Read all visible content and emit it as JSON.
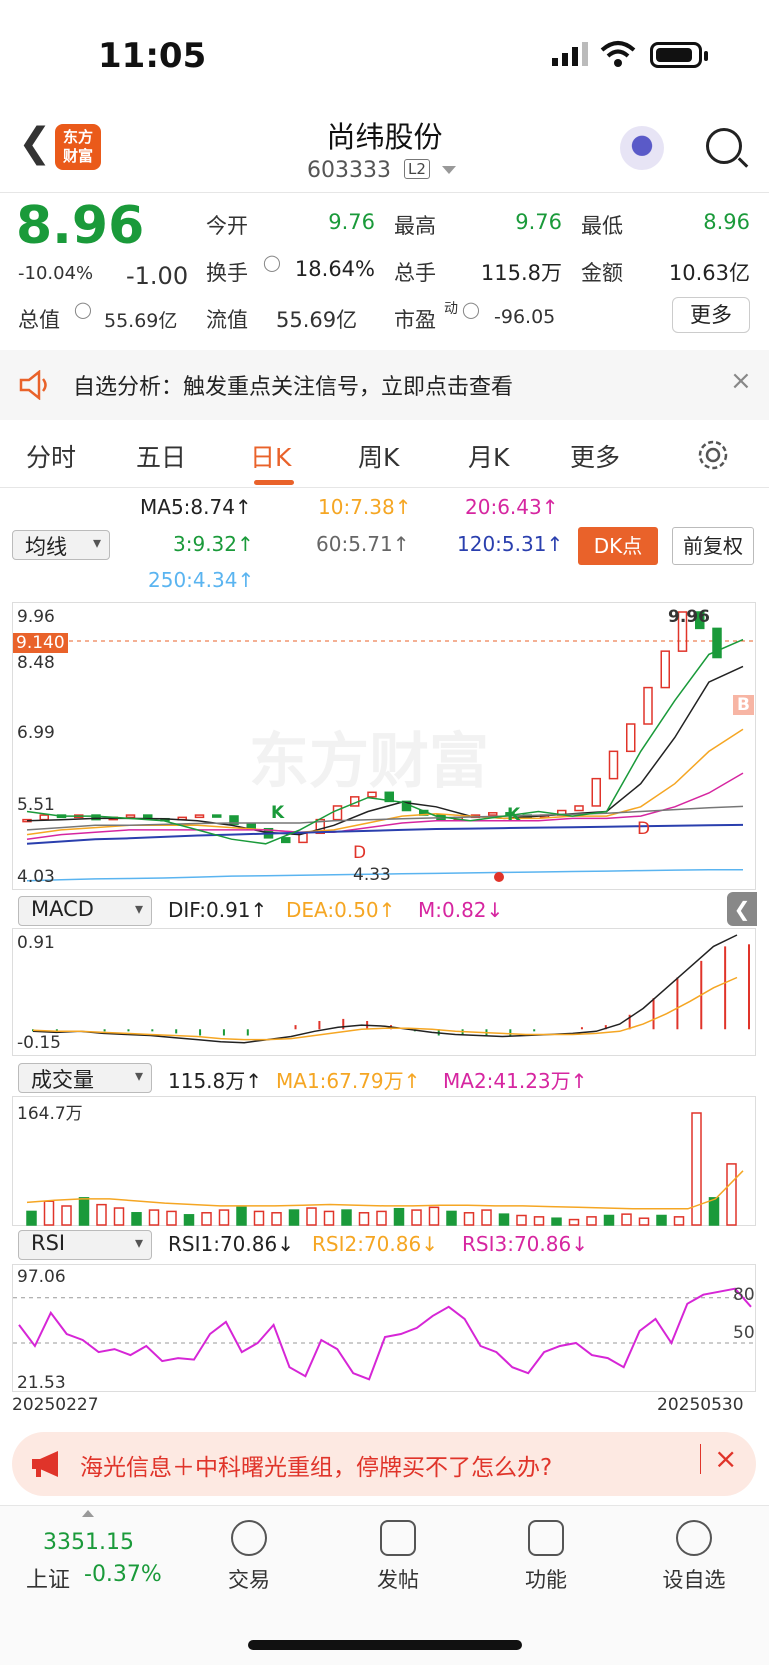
{
  "status": {
    "time": "11:05"
  },
  "header": {
    "logo_l1": "东方",
    "logo_l2": "财富",
    "title": "尚纬股份",
    "code": "603333",
    "level": "L2"
  },
  "quote": {
    "price": "8.96",
    "pct": "-10.04%",
    "chg": "-1.00",
    "r1": [
      {
        "k": "今开",
        "v": "9.76"
      },
      {
        "k": "最高",
        "v": "9.76"
      },
      {
        "k": "最低",
        "v": "8.96"
      }
    ],
    "r2": [
      {
        "k": "换手",
        "v": "18.64%"
      },
      {
        "k": "总手",
        "v": "115.8万"
      },
      {
        "k": "金额",
        "v": "10.63亿"
      }
    ],
    "r3": [
      {
        "k": "总值",
        "v": "55.69亿"
      },
      {
        "k": "流值",
        "v": "55.69亿"
      },
      {
        "k": "市盈",
        "sup": "动",
        "v": "-96.05"
      }
    ],
    "more": "更多"
  },
  "alert": {
    "text": "自选分析：触发重点关注信号，立即点击查看"
  },
  "tabs": [
    "分时",
    "五日",
    "日K",
    "周K",
    "月K",
    "更多"
  ],
  "ma": {
    "selector": "均线",
    "ma5": "MA5:8.74↑",
    "ma10": "10:7.38↑",
    "ma20": "20:6.43↑",
    "ma3": "3:9.32↑",
    "ma60": "60:5.71↑",
    "ma120": "120:5.31↑",
    "ma250": "250:4.34↑",
    "dk": "DK点",
    "fq": "前复权"
  },
  "kline": {
    "y_top": "9.96",
    "cur": "9.140",
    "y2": "8.48",
    "y3": "6.99",
    "y4": "5.51",
    "y_bot": "4.03",
    "hi": "9.96",
    "lo": "4.33",
    "watermark": "东方财富",
    "d1": "D",
    "d2": "D",
    "k1": "K",
    "k2": "K",
    "b": "B"
  },
  "macd": {
    "selector": "MACD",
    "dif": "DIF:0.91↑",
    "dea": "DEA:0.50↑",
    "m": "M:0.82↓",
    "top": "0.91",
    "bot": "-0.15"
  },
  "vol": {
    "selector": "成交量",
    "v": "115.8万↑",
    "ma1": "MA1:67.79万↑",
    "ma2": "MA2:41.23万↑",
    "top": "164.7万"
  },
  "rsi": {
    "selector": "RSI",
    "r1": "RSI1:70.86↓",
    "r2": "RSI2:70.86↓",
    "r3": "RSI3:70.86↓",
    "top": "97.06",
    "bot": "21.53",
    "l80": "80",
    "l50": "50",
    "d0": "20250227",
    "d1": "20250530"
  },
  "banner": {
    "text": "海光信息＋中科曙光重组，停牌买不了怎么办?"
  },
  "bottom": {
    "index": "3351.15",
    "index_name": "上证",
    "index_pct": "-0.37%",
    "items": [
      "交易",
      "发帖",
      "功能",
      "设自选"
    ]
  },
  "chart_data": [
    {
      "type": "line",
      "title": "RSI",
      "series": [
        {
          "name": "RSI1",
          "values": [
            62,
            48,
            70,
            56,
            52,
            44,
            46,
            42,
            48,
            38,
            40,
            39,
            56,
            64,
            44,
            50,
            62,
            34,
            28,
            52,
            46,
            30,
            26,
            54,
            56,
            60,
            68,
            74,
            66,
            48,
            44,
            34,
            30,
            44,
            48,
            50,
            42,
            40,
            34,
            58,
            66,
            50,
            76,
            82,
            84,
            86,
            74
          ]
        }
      ],
      "ylim": [
        21.53,
        97.06
      ]
    },
    {
      "type": "line",
      "title": "MACD",
      "series": [
        {
          "name": "DIF",
          "values": [
            -0.02,
            -0.03,
            -0.02,
            -0.04,
            -0.05,
            -0.06,
            -0.08,
            -0.1,
            -0.12,
            -0.13,
            -0.1,
            -0.07,
            -0.02,
            0.02,
            0.04,
            0.03,
            0,
            -0.03,
            -0.05,
            -0.06,
            -0.07,
            -0.06,
            -0.05,
            -0.04,
            -0.02,
            0.05,
            0.2,
            0.4,
            0.6,
            0.8,
            0.91
          ]
        },
        {
          "name": "DEA",
          "values": [
            -0.01,
            -0.02,
            -0.02,
            -0.03,
            -0.04,
            -0.05,
            -0.06,
            -0.07,
            -0.09,
            -0.1,
            -0.1,
            -0.09,
            -0.06,
            -0.03,
            0,
            0.01,
            0.01,
            0,
            -0.02,
            -0.03,
            -0.04,
            -0.05,
            -0.05,
            -0.05,
            -0.04,
            -0.02,
            0.05,
            0.15,
            0.27,
            0.4,
            0.5
          ]
        }
      ]
    }
  ]
}
